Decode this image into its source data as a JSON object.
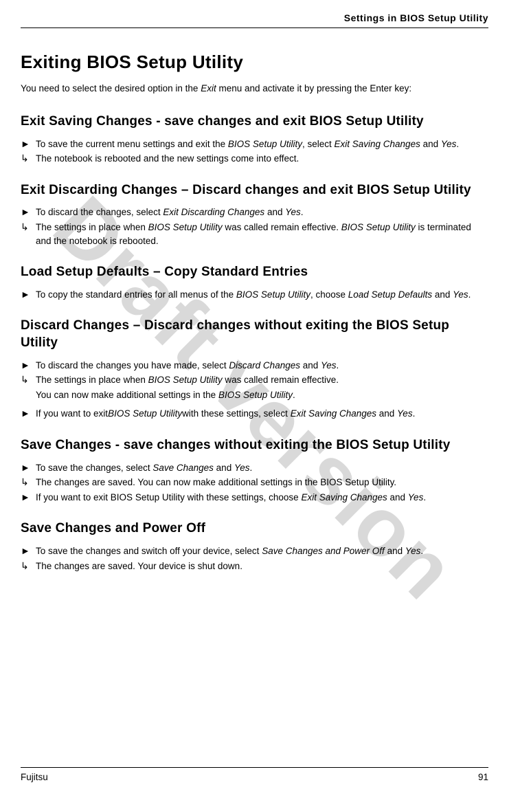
{
  "watermark": "Draft version",
  "running_head": "Settings in BIOS Setup Utility",
  "title": "Exiting BIOS Setup Utility",
  "intro": {
    "pre": "You need to select the desired option in the ",
    "it1": "Exit",
    "post": " menu and activate it by pressing the Enter key:"
  },
  "sections": {
    "s1": {
      "heading": "Exit Saving Changes - save changes and exit BIOS Setup Utility",
      "r1": {
        "a": "To save the current menu settings and exit the ",
        "b": "BIOS Setup Utility",
        "c": ", select ",
        "d": "Exit Saving Changes",
        "e": " and ",
        "f": "Yes",
        "g": "."
      },
      "r2": "The notebook is rebooted and the new settings come into effect."
    },
    "s2": {
      "heading": "Exit Discarding Changes – Discard changes and exit BIOS Setup Utility",
      "r1": {
        "a": "To discard the changes, select ",
        "b": "Exit Discarding Changes",
        "c": " and ",
        "d": "Yes",
        "e": "."
      },
      "r2": {
        "a": "The settings in place when ",
        "b": "BIOS Setup Utility",
        "c": " was called remain effective. ",
        "d": "BIOS Setup Utility",
        "e": " is terminated and the notebook is rebooted."
      }
    },
    "s3": {
      "heading": "Load Setup Defaults – Copy Standard Entries",
      "r1": {
        "a": "To copy the standard entries for all menus of the ",
        "b": "BIOS Setup Utility",
        "c": ", choose ",
        "d": "Load Setup Defaults",
        "e": " and ",
        "f": "Yes",
        "g": "."
      }
    },
    "s4": {
      "heading": "Discard Changes – Discard changes without exiting the BIOS Setup Utility",
      "r1": {
        "a": "To discard the changes you have made, select ",
        "b": "Discard Changes",
        "c": " and ",
        "d": "Yes",
        "e": "."
      },
      "r2": {
        "a": "The settings in place when ",
        "b": "BIOS Setup Utility",
        "c": " was called remain effective."
      },
      "r2b": {
        "a": "You can now make additional settings in the ",
        "b": "BIOS Setup Utility",
        "c": "."
      },
      "r3": {
        "a": "If you want to exit",
        "b": "BIOS Setup Utility",
        "c": "with these settings, select ",
        "d": "Exit Saving Changes",
        "e": " and ",
        "f": "Yes",
        "g": "."
      }
    },
    "s5": {
      "heading": "Save Changes - save changes without exiting the BIOS Setup Utility",
      "r1": {
        "a": "To save the changes, select ",
        "b": "Save Changes",
        "c": " and ",
        "d": "Yes",
        "e": "."
      },
      "r2": "The changes are saved. You can now make additional settings in the BIOS Setup Utility.",
      "r3": {
        "a": "If you want to exit BIOS Setup Utility with these settings, choose ",
        "b": "Exit Saving Changes",
        "c": " and ",
        "d": "Yes",
        "e": "."
      }
    },
    "s6": {
      "heading": "Save Changes and Power Off",
      "r1": {
        "a": "To save the changes and switch off your device, select ",
        "b": "Save Changes and Power Off",
        "c": " and ",
        "d": "Yes",
        "e": "."
      },
      "r2": "The changes are saved. Your device is shut down."
    }
  },
  "footer": {
    "left": "Fujitsu",
    "right": "91"
  }
}
